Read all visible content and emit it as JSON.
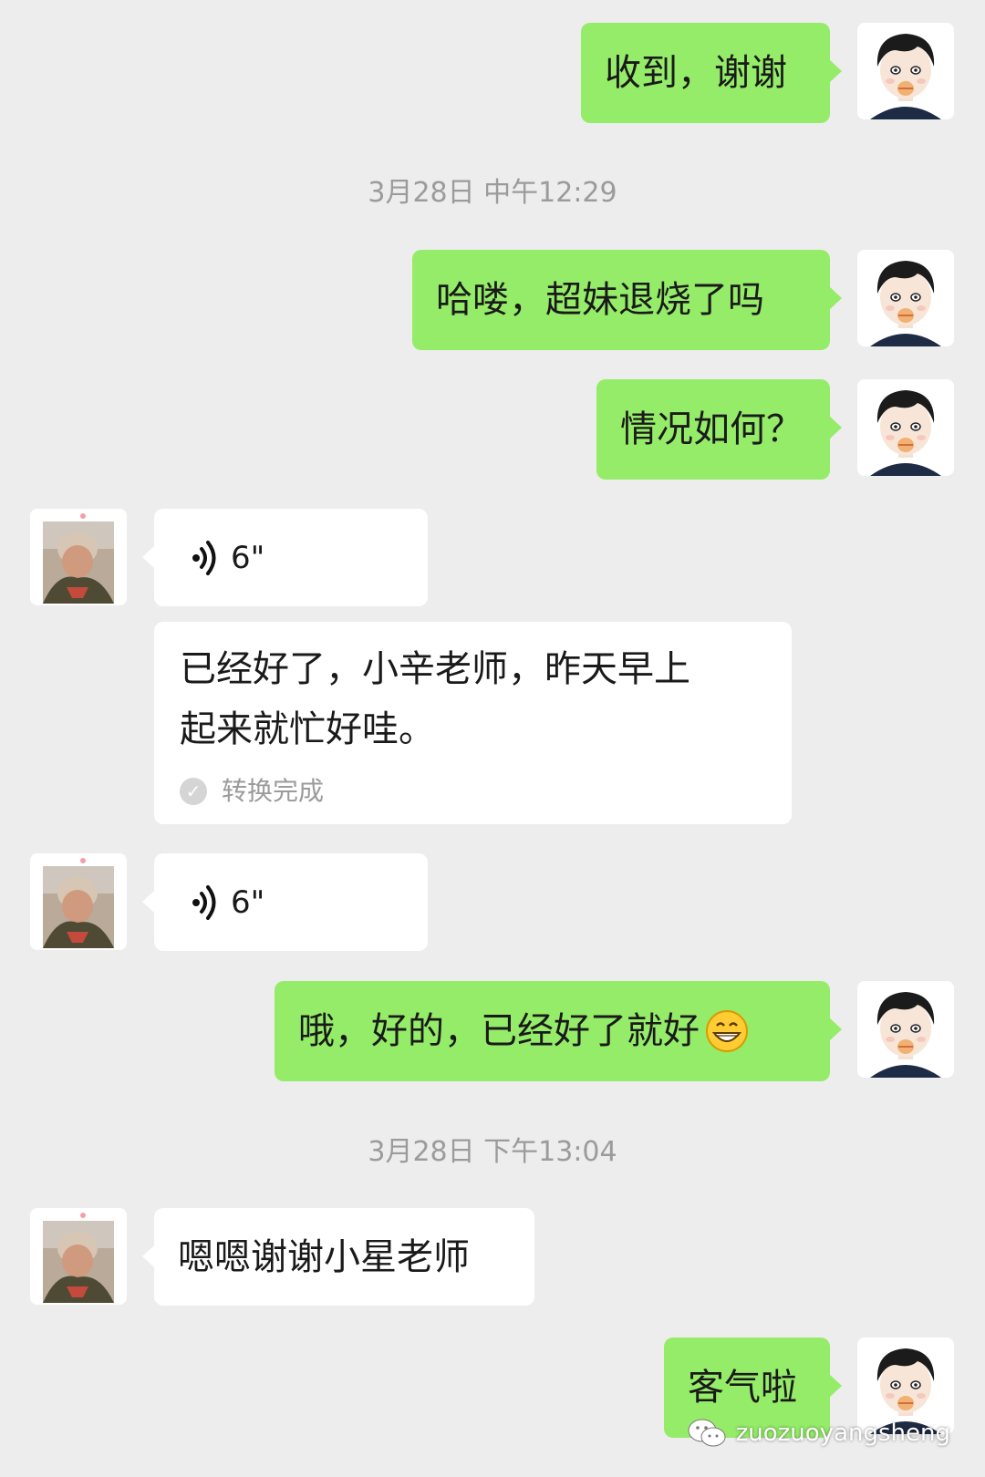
{
  "messages": {
    "m1": "收到，谢谢",
    "ts1": "3月28日 中午12:29",
    "m2": "哈喽，超妹退烧了吗",
    "m3": "情况如何？",
    "voice1": "6\"",
    "converted_line1": "已经好了，小辛老师，昨天早上",
    "converted_line2": "起来就忙好哇。",
    "converted_status": "转换完成",
    "voice2": "6\"",
    "m4": "哦，好的，已经好了就好",
    "ts2": "3月28日 下午13:04",
    "m5": "嗯嗯谢谢小星老师",
    "m6": "客气啦"
  },
  "watermark": "zuozuoyangsheng",
  "colors": {
    "background": "#ededed",
    "my_bubble": "#95ec69",
    "their_bubble": "#ffffff",
    "timestamp": "#9b9b9b"
  },
  "icons": {
    "voice": "voice-waves-icon",
    "emoji": "grin-emoji-icon",
    "check": "check-circle-icon",
    "watermark": "wechat-icon"
  }
}
